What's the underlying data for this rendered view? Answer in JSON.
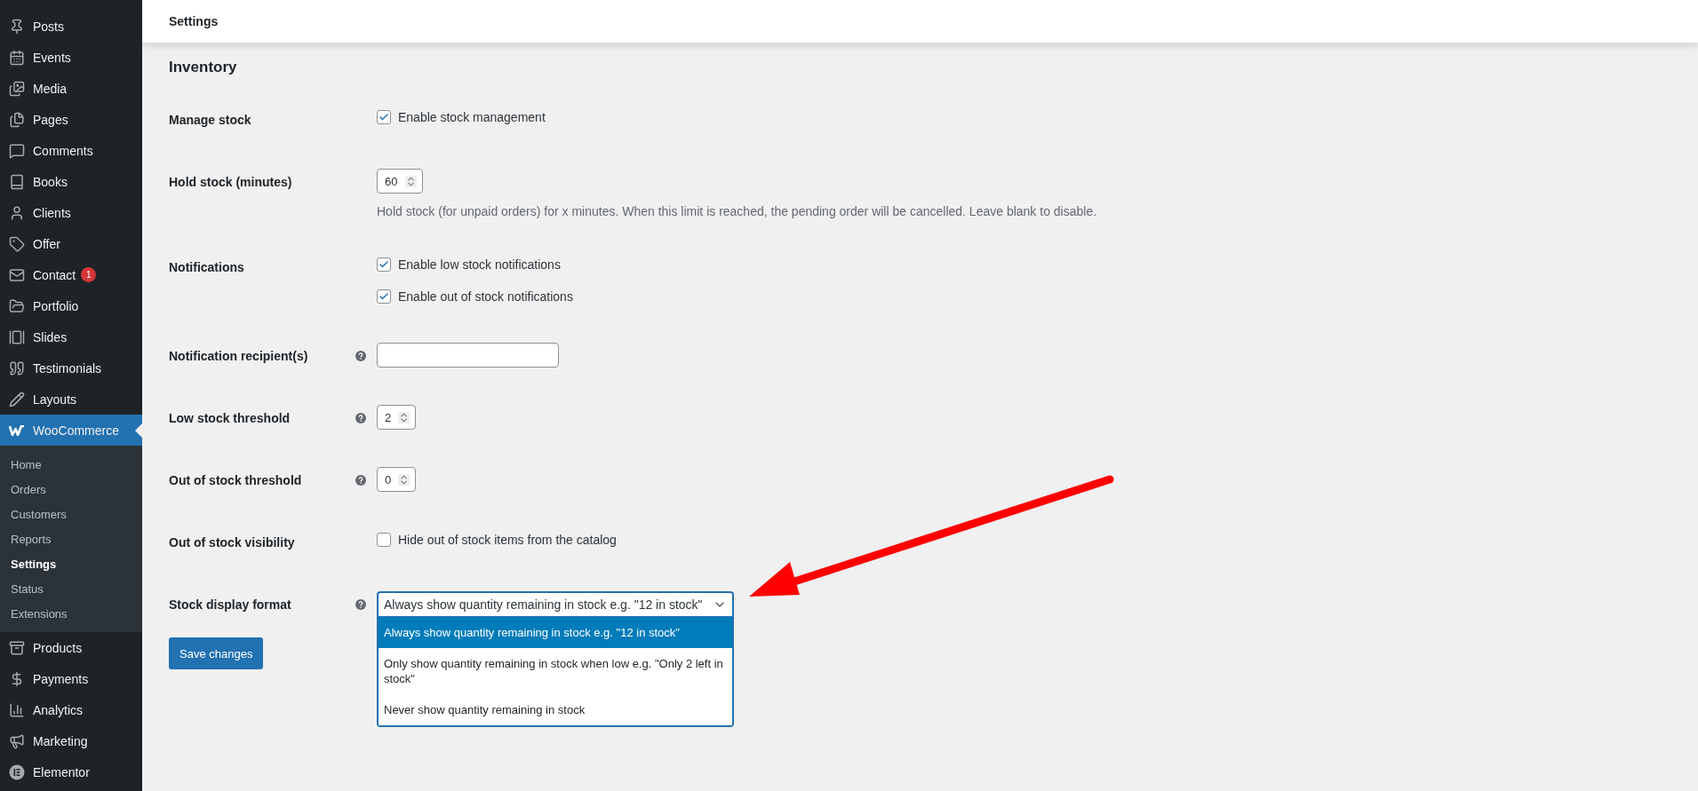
{
  "header": {
    "title": "Settings"
  },
  "sidebar": {
    "items": [
      {
        "label": "Posts",
        "selected": false
      },
      {
        "label": "Events",
        "selected": false
      },
      {
        "label": "Media",
        "selected": false
      },
      {
        "label": "Pages",
        "selected": false
      },
      {
        "label": "Comments",
        "selected": false
      },
      {
        "label": "Books",
        "selected": false
      },
      {
        "label": "Clients",
        "selected": false
      },
      {
        "label": "Offer",
        "selected": false
      },
      {
        "label": "Contact",
        "selected": false,
        "badge": "1"
      },
      {
        "label": "Portfolio",
        "selected": false
      },
      {
        "label": "Slides",
        "selected": false
      },
      {
        "label": "Testimonials",
        "selected": false
      },
      {
        "label": "Layouts",
        "selected": false
      },
      {
        "label": "WooCommerce",
        "selected": true,
        "children": [
          {
            "label": "Home",
            "selected": false
          },
          {
            "label": "Orders",
            "selected": false
          },
          {
            "label": "Customers",
            "selected": false
          },
          {
            "label": "Reports",
            "selected": false
          },
          {
            "label": "Settings",
            "selected": true
          },
          {
            "label": "Status",
            "selected": false
          },
          {
            "label": "Extensions",
            "selected": false
          }
        ]
      },
      {
        "label": "Products",
        "selected": false
      },
      {
        "label": "Payments",
        "selected": false
      },
      {
        "label": "Analytics",
        "selected": false
      },
      {
        "label": "Marketing",
        "selected": false
      },
      {
        "label": "Elementor",
        "selected": false
      }
    ]
  },
  "section": {
    "title": "Inventory",
    "rows": [
      {
        "kind": "checkbox",
        "label": "Manage stock",
        "help": false,
        "options": [
          {
            "label": "Enable stock management",
            "checked": true
          }
        ]
      },
      {
        "kind": "number",
        "label": "Hold stock (minutes)",
        "help": false,
        "value": "60",
        "description": "Hold stock (for unpaid orders) for x minutes. When this limit is reached, the pending order will be cancelled. Leave blank to disable."
      },
      {
        "kind": "checkbox",
        "label": "Notifications",
        "help": false,
        "options": [
          {
            "label": "Enable low stock notifications",
            "checked": true
          },
          {
            "label": "Enable out of stock notifications",
            "checked": true
          }
        ]
      },
      {
        "kind": "text",
        "label": "Notification recipient(s)",
        "help": true
      },
      {
        "kind": "number",
        "label": "Low stock threshold",
        "help": true,
        "value": "2"
      },
      {
        "kind": "number",
        "label": "Out of stock threshold",
        "help": true,
        "value": "0"
      },
      {
        "kind": "checkbox",
        "label": "Out of stock visibility",
        "help": false,
        "options": [
          {
            "label": "Hide out of stock items from the catalog",
            "checked": false
          }
        ]
      },
      {
        "kind": "select",
        "label": "Stock display format",
        "help": true,
        "value": "Always show quantity remaining in stock e.g. \"12 in stock\"",
        "expanded": true,
        "options": [
          {
            "label": "Always show quantity remaining in stock e.g. \"12 in stock\"",
            "selected": true
          },
          {
            "label": "Only show quantity remaining in stock when low e.g. \"Only 2 left in stock\"",
            "selected": false
          },
          {
            "label": "Never show quantity remaining in stock",
            "selected": false
          }
        ]
      }
    ]
  },
  "save_button": "Save changes"
}
